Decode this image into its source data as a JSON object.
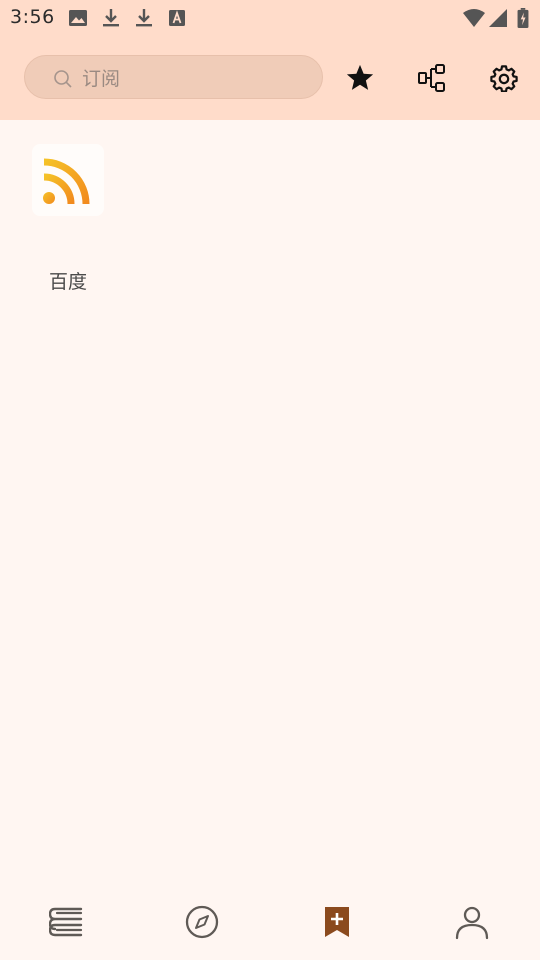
{
  "status_bar": {
    "time": "3:56",
    "icons": [
      "image-icon",
      "download-icon",
      "download-icon",
      "font-icon",
      "wifi-icon",
      "signal-icon",
      "battery-charging-icon"
    ]
  },
  "search": {
    "placeholder": "订阅",
    "value": ""
  },
  "toolbar": {
    "icons": [
      "star-icon",
      "rule-source-icon",
      "settings-gear-icon"
    ]
  },
  "subscriptions": [
    {
      "label": "百度",
      "icon": "rss-icon"
    }
  ],
  "bottom_nav": {
    "items": [
      {
        "icon": "bookshelf-icon",
        "selected": false
      },
      {
        "icon": "compass-discover-icon",
        "selected": false
      },
      {
        "icon": "bookmark-add-icon",
        "selected": true
      },
      {
        "icon": "person-icon",
        "selected": false
      }
    ]
  },
  "colors": {
    "header_bg": "#FFDCCA",
    "page_bg": "#FFF6F2",
    "accent": "#8B4A1E",
    "rss_orange": "#F39A1E"
  }
}
